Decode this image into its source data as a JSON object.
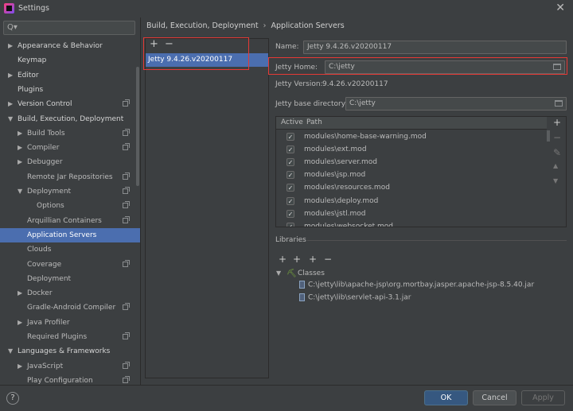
{
  "window": {
    "title": "Settings",
    "close_glyph": "✕"
  },
  "search": {
    "placeholder": "Q▾",
    "value": ""
  },
  "sidebar": {
    "items": [
      {
        "label": "Appearance & Behavior",
        "level": 0,
        "arrow": "▶",
        "bold": true,
        "cfg": false
      },
      {
        "label": "Keymap",
        "level": 0,
        "arrow": "",
        "bold": true,
        "cfg": false
      },
      {
        "label": "Editor",
        "level": 0,
        "arrow": "▶",
        "bold": true,
        "cfg": false
      },
      {
        "label": "Plugins",
        "level": 0,
        "arrow": "",
        "bold": true,
        "cfg": false
      },
      {
        "label": "Version Control",
        "level": 0,
        "arrow": "▶",
        "bold": true,
        "cfg": true
      },
      {
        "label": "Build, Execution, Deployment",
        "level": 0,
        "arrow": "▼",
        "bold": true,
        "cfg": false
      },
      {
        "label": "Build Tools",
        "level": 1,
        "arrow": "▶",
        "bold": false,
        "cfg": true
      },
      {
        "label": "Compiler",
        "level": 1,
        "arrow": "▶",
        "bold": false,
        "cfg": true
      },
      {
        "label": "Debugger",
        "level": 1,
        "arrow": "▶",
        "bold": false,
        "cfg": false
      },
      {
        "label": "Remote Jar Repositories",
        "level": 1,
        "arrow": "",
        "bold": false,
        "cfg": true
      },
      {
        "label": "Deployment",
        "level": 1,
        "arrow": "▼",
        "bold": false,
        "cfg": true
      },
      {
        "label": "Options",
        "level": 2,
        "arrow": "",
        "bold": false,
        "cfg": true
      },
      {
        "label": "Arquillian Containers",
        "level": 1,
        "arrow": "",
        "bold": false,
        "cfg": true
      },
      {
        "label": "Application Servers",
        "level": 1,
        "arrow": "",
        "bold": false,
        "cfg": false,
        "selected": true
      },
      {
        "label": "Clouds",
        "level": 1,
        "arrow": "",
        "bold": false,
        "cfg": false
      },
      {
        "label": "Coverage",
        "level": 1,
        "arrow": "",
        "bold": false,
        "cfg": true
      },
      {
        "label": "Deployment",
        "level": 1,
        "arrow": "",
        "bold": false,
        "cfg": false
      },
      {
        "label": "Docker",
        "level": 1,
        "arrow": "▶",
        "bold": false,
        "cfg": false
      },
      {
        "label": "Gradle-Android Compiler",
        "level": 1,
        "arrow": "",
        "bold": false,
        "cfg": true
      },
      {
        "label": "Java Profiler",
        "level": 1,
        "arrow": "▶",
        "bold": false,
        "cfg": false
      },
      {
        "label": "Required Plugins",
        "level": 1,
        "arrow": "",
        "bold": false,
        "cfg": true
      },
      {
        "label": "Languages & Frameworks",
        "level": 0,
        "arrow": "▼",
        "bold": true,
        "cfg": false
      },
      {
        "label": "JavaScript",
        "level": 1,
        "arrow": "▶",
        "bold": false,
        "cfg": true
      },
      {
        "label": "Play Configuration",
        "level": 1,
        "arrow": "",
        "bold": false,
        "cfg": true
      }
    ]
  },
  "breadcrumb": {
    "parent": "Build, Execution, Deployment",
    "separator": "›",
    "current": "Application Servers"
  },
  "servers": {
    "add_glyph": "+",
    "remove_glyph": "−",
    "items": [
      "Jetty 9.4.26.v20200117"
    ]
  },
  "form": {
    "name_label": "Name:",
    "name_value": "Jetty 9.4.26.v20200117",
    "home_label": "Jetty Home:",
    "home_value": "C:\\jetty",
    "version_label": "Jetty Version:",
    "version_value": "9.4.26.v20200117",
    "base_label": "Jetty base directory:",
    "base_value": "C:\\jetty"
  },
  "modules": {
    "col_active": "Active",
    "col_path": "Path",
    "rows": [
      "modules\\home-base-warning.mod",
      "modules\\ext.mod",
      "modules\\server.mod",
      "modules\\jsp.mod",
      "modules\\resources.mod",
      "modules\\deploy.mod",
      "modules\\jstl.mod",
      "modules\\websocket.mod"
    ],
    "checkmark": "✓",
    "side_tools": [
      "+",
      "−",
      "✎",
      "▲",
      "▼"
    ]
  },
  "libraries": {
    "header": "Libraries",
    "tools": [
      "+",
      "+",
      "+",
      "−"
    ],
    "classes_arrow": "▼",
    "classes_label": "Classes",
    "jars": [
      "C:\\jetty\\lib\\apache-jsp\\org.mortbay.jasper.apache-jsp-8.5.40.jar",
      "C:\\jetty\\lib\\servlet-api-3.1.jar"
    ]
  },
  "footer": {
    "help": "?",
    "ok": "OK",
    "cancel": "Cancel",
    "apply": "Apply"
  }
}
